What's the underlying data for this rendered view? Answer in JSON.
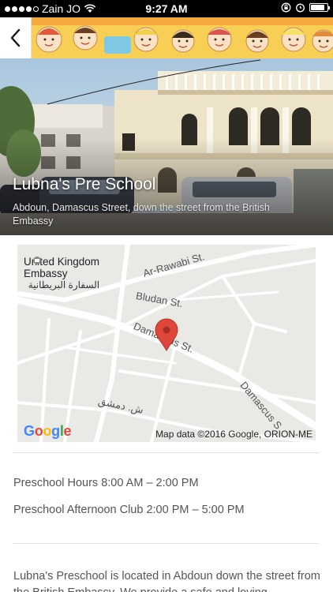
{
  "status_bar": {
    "carrier": "Zain JO",
    "time": "9:27 AM",
    "icons": [
      "signal-dots",
      "wifi-icon",
      "rotation-lock-icon",
      "alarm-icon",
      "battery-icon"
    ],
    "battery_level": 0.85
  },
  "header": {
    "back_icon": "chevron-left-icon",
    "banner": "cartoon-children-banner"
  },
  "hero": {
    "title": "Lubna's Pre School",
    "subtitle": "Abdoun, Damascus Street, down the street from the British Embassy"
  },
  "map": {
    "embassy_name_en": "United Kingdom\nEmbassy",
    "embassy_name_ar": "السفارة البريطانية",
    "streets": {
      "ar_rawabi": "Ar-Rawabi St.",
      "bludan": "Bludan St.",
      "damascus": "Damascus St.",
      "damascus_2": "Damascus S",
      "damascus_ar": "ش. دمشق"
    },
    "logo": "Google",
    "attribution": "Map data ©2016 Google, ORION-ME",
    "pin_color": "#e0473c"
  },
  "hours": {
    "preschool": "Preschool Hours 8:00 AM – 2:00 PM",
    "afternoon_club": "Preschool Afternoon Club 2:00 PM – 5:00 PM"
  },
  "description": "Lubna's Preschool is located in Abdoun down the street from the British Embassy. We provide a safe and loving"
}
